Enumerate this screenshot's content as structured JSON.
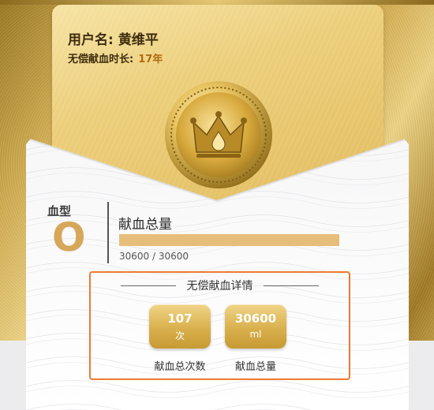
{
  "user": {
    "name_label": "用户名: 黄维平",
    "duration_prefix": "无偿献血时长:",
    "duration_value": "17年"
  },
  "blood": {
    "type_label": "血型",
    "type_value": "O"
  },
  "total": {
    "title": "献血总量",
    "progress_text": "30600 / 30600",
    "progress_fraction": 1.0
  },
  "details": {
    "header": "无偿献血详情",
    "stats": [
      {
        "value": "107",
        "unit": "次",
        "caption": "献血总次数"
      },
      {
        "value": "30600",
        "unit": "ml",
        "caption": "献血总量"
      }
    ]
  },
  "colors": {
    "accent_orange": "#ef7a31",
    "gold": "#d6a759",
    "progress_fill": "#e7bd7b"
  },
  "icons": {
    "medal": "crown-medal-icon"
  }
}
